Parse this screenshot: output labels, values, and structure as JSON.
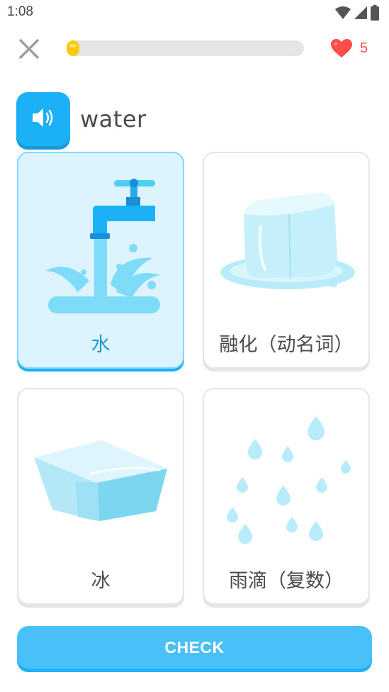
{
  "status_bar": {
    "time": "1:08"
  },
  "header": {
    "close_icon": "close-icon",
    "progress": 0.03,
    "hearts": {
      "icon": "heart-icon",
      "count": "5"
    }
  },
  "prompt": {
    "word": "water",
    "speaker_icon": "speaker-icon"
  },
  "options": [
    {
      "label": "水",
      "icon": "faucet-icon",
      "selected": true
    },
    {
      "label": "融化（动名词）",
      "icon": "melting-ice-icon",
      "selected": false
    },
    {
      "label": "冰",
      "icon": "ice-block-icon",
      "selected": false
    },
    {
      "label": "雨滴（复数）",
      "icon": "raindrops-icon",
      "selected": false
    }
  ],
  "footer": {
    "check_label": "CHECK"
  },
  "colors": {
    "accent": "#1cb0f6",
    "selected_bg": "#ddf4ff",
    "progress": "#ffc800",
    "heart": "#ff4b4b",
    "check_button": "#49c0f8"
  }
}
